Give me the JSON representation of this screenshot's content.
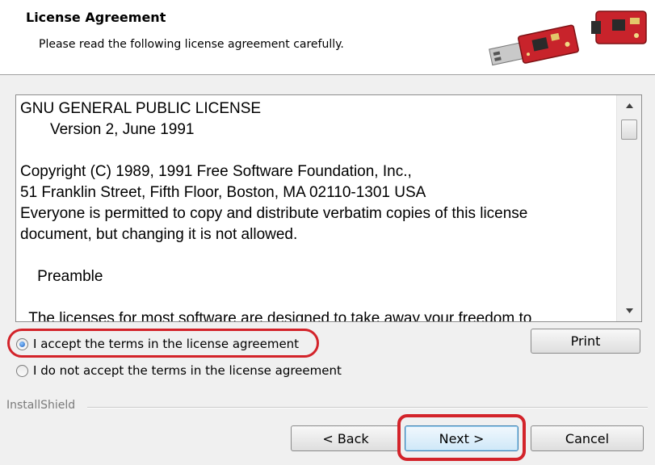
{
  "header": {
    "title": "License Agreement",
    "subtitle": "Please read the following license agreement carefully."
  },
  "license": {
    "text": "GNU GENERAL PUBLIC LICENSE\n       Version 2, June 1991\n\nCopyright (C) 1989, 1991 Free Software Foundation, Inc.,\n51 Franklin Street, Fifth Floor, Boston, MA 02110-1301 USA\nEveryone is permitted to copy and distribute verbatim copies of this license\ndocument, but changing it is not allowed.\n\n    Preamble\n\n  The licenses for most software are designed to take away your freedom to"
  },
  "options": {
    "accept_label": "I accept the terms in the license agreement",
    "decline_label": "I do not accept the terms in the license agreement",
    "selected": "accept"
  },
  "buttons": {
    "print": "Print",
    "back": "< Back",
    "next": "Next >",
    "cancel": "Cancel"
  },
  "footer": {
    "brand": "InstallShield"
  },
  "colors": {
    "highlight": "#d3232a",
    "board": "#c8232b"
  },
  "icons": {
    "scroll_up": "triangle-up-icon",
    "scroll_down": "triangle-down-icon",
    "header_art": "usb-board-illustration"
  }
}
